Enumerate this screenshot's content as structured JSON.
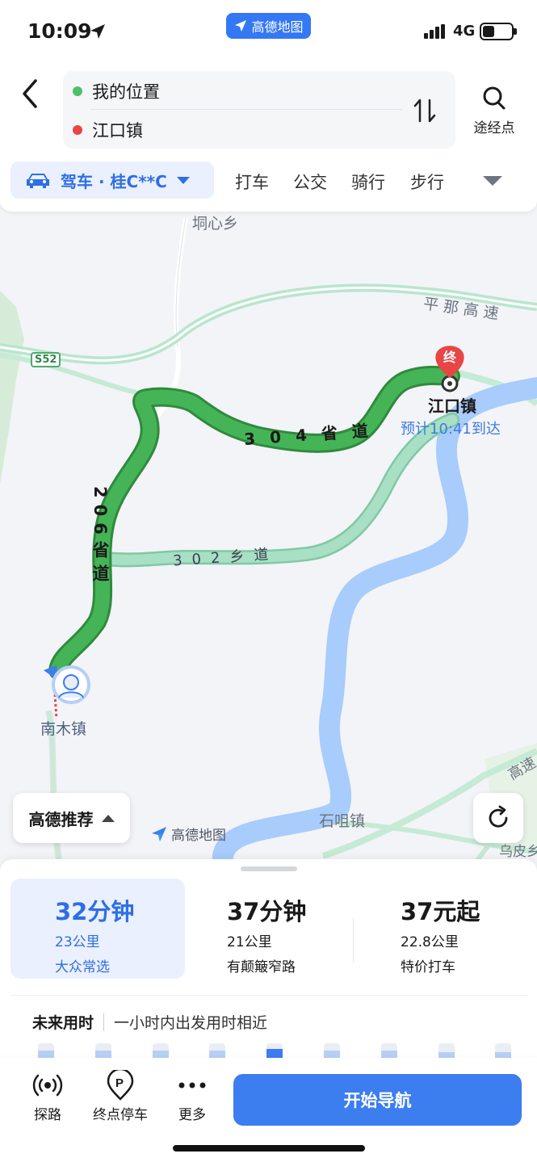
{
  "status": {
    "time": "10:09",
    "network": "4G",
    "brand": "高德地图",
    "battery_level": 0.4
  },
  "route": {
    "start": "我的位置",
    "end": "江口镇",
    "waypoint_label": "途经点"
  },
  "modes": {
    "active": "驾车 · 桂C**C",
    "items": [
      "打车",
      "公交",
      "骑行",
      "步行"
    ]
  },
  "map": {
    "labels": {
      "tongxin": "垌心乡",
      "expressway": "平那高速",
      "s52": "S52",
      "dest_town": "江口镇",
      "eta": "预计10:41到达",
      "road304": "304省道",
      "road206": "206省道",
      "road302": "302乡道",
      "origin_town": "南木镇",
      "shiju": "石咀镇",
      "wupi": "乌皮乡",
      "gao_su_right": "高速",
      "end_marker": "终"
    },
    "logo": "高德地图",
    "recommend": "高德推荐"
  },
  "routes": [
    {
      "duration": "32分钟",
      "distance": "23公里",
      "tag": "大众常选"
    },
    {
      "duration": "37分钟",
      "distance": "21公里",
      "tag": "有颠簸窄路"
    },
    {
      "duration": "37元起",
      "distance": "22.8公里",
      "tag": "特价打车"
    }
  ],
  "future": {
    "title": "未来用时",
    "desc": "一小时内出发用时相近",
    "levels": [
      0.55,
      0.55,
      0.55,
      0.55,
      0.65,
      0.55,
      0.55,
      0.45,
      0.45
    ],
    "current_index": 4
  },
  "bottom": {
    "tanlu": "探路",
    "parking": "终点停车",
    "more": "更多",
    "start": "开始导航"
  },
  "colors": {
    "accent": "#3c7df0",
    "route_green": "#3daa4f",
    "alt_route": "#9fd9c0",
    "river": "#a8ccfb",
    "destination": "#e84545"
  }
}
